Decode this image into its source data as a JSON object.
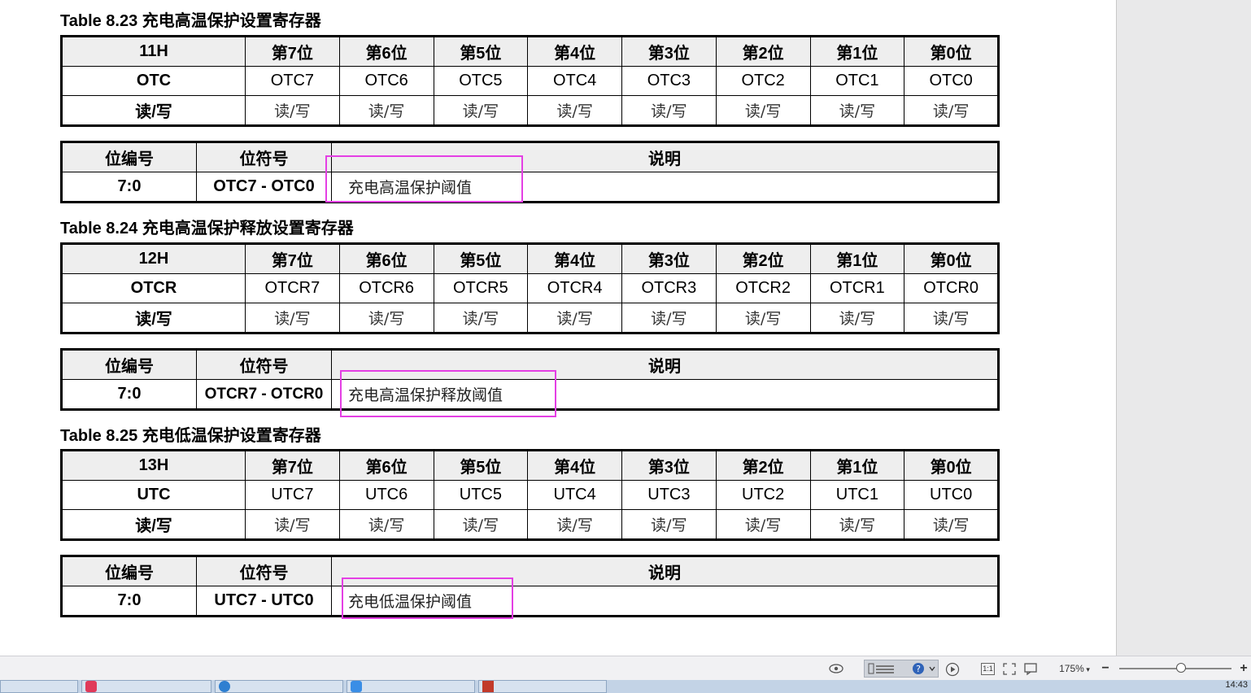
{
  "tables": [
    {
      "caption": "Table 8.23 充电高温保护设置寄存器",
      "register": {
        "address": "11H",
        "bit_headers": [
          "第7位",
          "第6位",
          "第5位",
          "第4位",
          "第3位",
          "第2位",
          "第1位",
          "第0位"
        ],
        "name_label": "OTC",
        "bits": [
          "OTC7",
          "OTC6",
          "OTC5",
          "OTC4",
          "OTC3",
          "OTC2",
          "OTC1",
          "OTC0"
        ],
        "rw_label": "读/写",
        "rw": [
          "读/写",
          "读/写",
          "读/写",
          "读/写",
          "读/写",
          "读/写",
          "读/写",
          "读/写"
        ]
      },
      "description": {
        "headers": [
          "位编号",
          "位符号",
          "说明"
        ],
        "bit_no": "7:0",
        "symbol": "OTC7 - OTC0",
        "note": "充电高温保护阈值"
      }
    },
    {
      "caption": "Table 8.24 充电高温保护释放设置寄存器",
      "register": {
        "address": "12H",
        "bit_headers": [
          "第7位",
          "第6位",
          "第5位",
          "第4位",
          "第3位",
          "第2位",
          "第1位",
          "第0位"
        ],
        "name_label": "OTCR",
        "bits": [
          "OTCR7",
          "OTCR6",
          "OTCR5",
          "OTCR4",
          "OTCR3",
          "OTCR2",
          "OTCR1",
          "OTCR0"
        ],
        "rw_label": "读/写",
        "rw": [
          "读/写",
          "读/写",
          "读/写",
          "读/写",
          "读/写",
          "读/写",
          "读/写",
          "读/写"
        ]
      },
      "description": {
        "headers": [
          "位编号",
          "位符号",
          "说明"
        ],
        "bit_no": "7:0",
        "symbol": "OTCR7 - OTCR0",
        "note": "充电高温保护释放阈值"
      }
    },
    {
      "caption": "Table 8.25 充电低温保护设置寄存器",
      "register": {
        "address": "13H",
        "bit_headers": [
          "第7位",
          "第6位",
          "第5位",
          "第4位",
          "第3位",
          "第2位",
          "第1位",
          "第0位"
        ],
        "name_label": "UTC",
        "bits": [
          "UTC7",
          "UTC6",
          "UTC5",
          "UTC4",
          "UTC3",
          "UTC2",
          "UTC1",
          "UTC0"
        ],
        "rw_label": "读/写",
        "rw": [
          "读/写",
          "读/写",
          "读/写",
          "读/写",
          "读/写",
          "读/写",
          "读/写",
          "读/写"
        ]
      },
      "description": {
        "headers": [
          "位编号",
          "位符号",
          "说明"
        ],
        "bit_no": "7:0",
        "symbol": "UTC7 - UTC0",
        "note": "充电低温保护阈值"
      }
    }
  ],
  "highlight_color": "#e43fe4",
  "statusbar": {
    "zoom_level": "175%",
    "zoom_fraction": 0.55,
    "zoom_out_symbol": "−",
    "zoom_in_symbol": "+",
    "fit_label": "1:1",
    "icons": [
      "eye-icon",
      "page-view-icon",
      "help-icon",
      "play-icon",
      "actual-size-icon",
      "fit-page-icon",
      "comment-icon"
    ]
  },
  "taskbar": {
    "clock": "14:43"
  }
}
